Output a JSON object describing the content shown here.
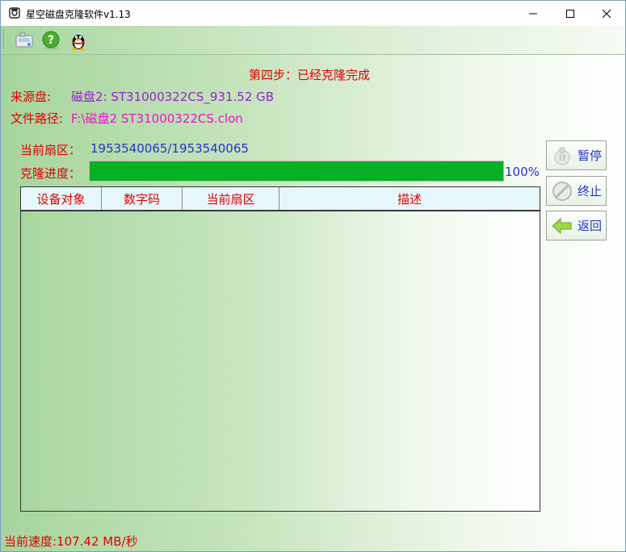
{
  "window": {
    "title": "星空磁盘克隆软件v1.13",
    "controls": {
      "minimize": "minimize-icon",
      "maximize": "maximize-icon",
      "close": "close-icon"
    }
  },
  "toolbar": {
    "buttons": [
      {
        "icon": "disk-tool-icon"
      },
      {
        "icon": "help-icon"
      },
      {
        "icon": "qq-penguin-icon"
      }
    ]
  },
  "main": {
    "step_title": "第四步：已经克隆完成",
    "source_label": "来源盘:",
    "source_value": "磁盘2: ST31000322CS_931.52 GB",
    "path_label": "文件路径:",
    "path_value": "F:\\磁盘2 ST31000322CS.clon",
    "sector_label": "当前扇区：",
    "sector_value": "1953540065/1953540065",
    "progress_label": "克隆进度：",
    "progress_percent_text": "100%",
    "progress_fraction": 1.0
  },
  "table": {
    "columns": [
      "设备对象",
      "数字码",
      "当前扇区",
      "描述"
    ],
    "rows": []
  },
  "side_buttons": [
    {
      "label": "暂停",
      "icon": "pause-icon"
    },
    {
      "label": "终止",
      "icon": "stop-icon"
    },
    {
      "label": "返回",
      "icon": "back-arrow-icon"
    }
  ],
  "status": {
    "speed_text": "当前速度:107.42 MB/秒"
  },
  "colors": {
    "label_red": "#e00000",
    "value_blue": "#2233cc",
    "source_purple": "#9922cc",
    "path_magenta": "#ee11cc",
    "progress_green": "#06b025"
  }
}
